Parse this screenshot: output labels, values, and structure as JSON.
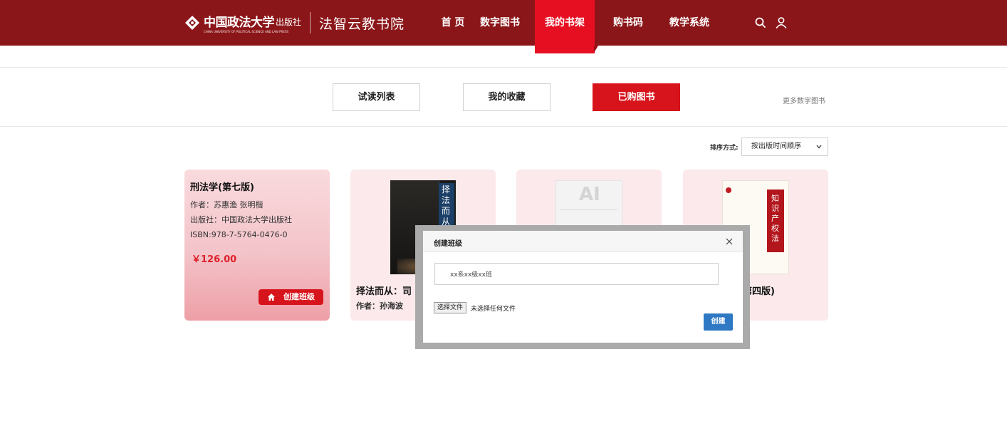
{
  "header": {
    "logo_name": "中国政法大学",
    "logo_press": "出版社",
    "logo_subtitle": "CHINA UNIVERSITY OF POLITICAL SCIENCE AND LAW PRESS",
    "brand": "法智云教书院",
    "nav": [
      "首 页",
      "数字图书",
      "我的书架",
      "购书码",
      "教学系统"
    ],
    "active_nav": "我的书架",
    "icons": [
      "search-icon",
      "user-icon"
    ],
    "color_bar": "#8b1619",
    "color_active": "#e60f22"
  },
  "tabs": {
    "items": [
      "试读列表",
      "我的收藏",
      "已购图书"
    ],
    "active": "已购图书",
    "more_link": "更多数字图书"
  },
  "sort": {
    "label": "排序方式:",
    "selected": "按出版时间顺序"
  },
  "books": [
    {
      "title": "刑法学(第七版)",
      "author": "作者：苏惠渔 张明楷",
      "publisher": "出版社：中国政法大学出版社",
      "isbn": "ISBN:978-7-5764-0476-0",
      "price": "￥126.00",
      "button": "创建班级"
    },
    {
      "title": "择法而从：司",
      "author": "作者：孙海波",
      "cover_text": "择法而从"
    },
    {
      "cover_text": "AI"
    },
    {
      "title": "第四版)",
      "cover_text": "知识产权法"
    }
  ],
  "dialog": {
    "title": "创建班级",
    "input_value": "xx系xx级xx班",
    "file_button": "选择文件",
    "file_status": "未选择任何文件",
    "submit": "创建",
    "color_submit": "#2f79c4"
  }
}
